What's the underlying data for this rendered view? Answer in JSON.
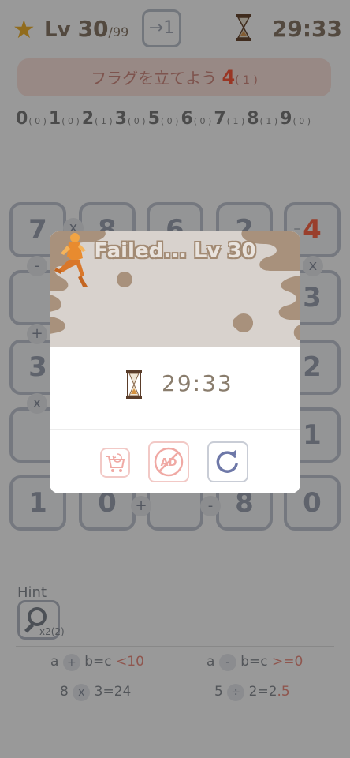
{
  "header": {
    "level_prefix": "Lv",
    "level": "30",
    "level_max": "/99",
    "skip_label": "→1",
    "timer": "29:33"
  },
  "mission": {
    "text": "フラグを立てよう",
    "count": "4",
    "sub": "( 1 )"
  },
  "digit_counts": [
    {
      "digit": "0",
      "count": "( 0 )"
    },
    {
      "digit": "1",
      "count": "( 0 )"
    },
    {
      "digit": "2",
      "count": "( 1 )"
    },
    {
      "digit": "3",
      "count": "( 0 )"
    },
    {
      "digit": "5",
      "count": "( 0 )"
    },
    {
      "digit": "6",
      "count": "( 0 )"
    },
    {
      "digit": "7",
      "count": "( 1 )"
    },
    {
      "digit": "8",
      "count": "( 1 )"
    },
    {
      "digit": "9",
      "count": "( 0 )"
    }
  ],
  "board": {
    "row1": [
      "7",
      "8",
      "6",
      "2",
      "4"
    ],
    "row2": [
      "",
      "",
      "",
      "",
      "3"
    ],
    "row3": [
      "3",
      "",
      "",
      "",
      "2"
    ],
    "row4": [
      "",
      "",
      "",
      "",
      "1"
    ],
    "row5": [
      "1",
      "0",
      "",
      "8",
      "0"
    ],
    "ops": [
      "x",
      "-",
      "x",
      "+",
      "x",
      "+",
      "-",
      "="
    ]
  },
  "hint": {
    "title": "Hint",
    "count": "x2(2)",
    "rules": [
      {
        "a": "a",
        "op": "+",
        "rest": "b=c",
        "cond": "<10"
      },
      {
        "a": "a",
        "op": "-",
        "rest": "b=c",
        "cond": ">=0"
      },
      {
        "a": "8",
        "op": "x",
        "rest": "3=",
        "cond_pre": "",
        "cond": "24",
        "cond_mark": "2"
      },
      {
        "a": "5",
        "op": "÷",
        "rest": "2=2",
        "cond": ".5"
      }
    ]
  },
  "modal": {
    "title": "Failed... Lv 30",
    "time": "29:33",
    "buttons": {
      "shop": "shop-cart",
      "noad": "AD",
      "retry": "retry"
    }
  },
  "colors": {
    "dim_overlay": "#000000",
    "modal_header_bg": "#d5cfca",
    "modal_blob": "#a8917c",
    "title_outline": "#a28a73",
    "retry_accent": "#6e78a8",
    "noad_accent": "#f0a9a4"
  }
}
